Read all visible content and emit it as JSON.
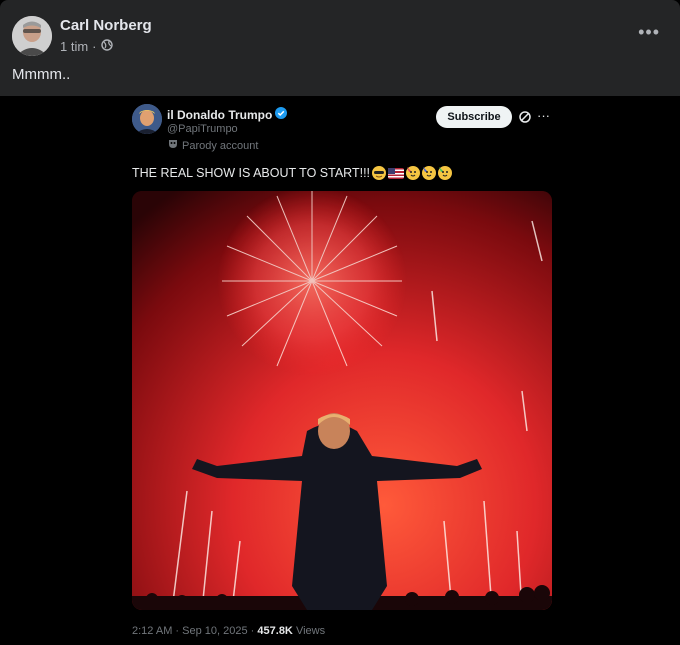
{
  "post": {
    "author": "Carl Norberg",
    "time": "1 tim",
    "separator": "·",
    "text": "Mmmm..",
    "more_label": "•••"
  },
  "tweet": {
    "display_name": "il Donaldo Trumpo",
    "handle": "@PapiTrumpo",
    "parody_label": "Parody account",
    "subscribe_label": "Subscribe",
    "more_label": "···",
    "text": "THE REAL SHOW IS ABOUT TO START!!!",
    "emojis": [
      "sunglasses-face",
      "us-flag",
      "partying-face",
      "partying-face",
      "partying-face"
    ],
    "footer": {
      "time": "2:12 AM",
      "date": "Sep 10, 2025",
      "views_count": "457.8K",
      "views_label": "Views"
    },
    "verified_color": "#1d9bf0"
  }
}
